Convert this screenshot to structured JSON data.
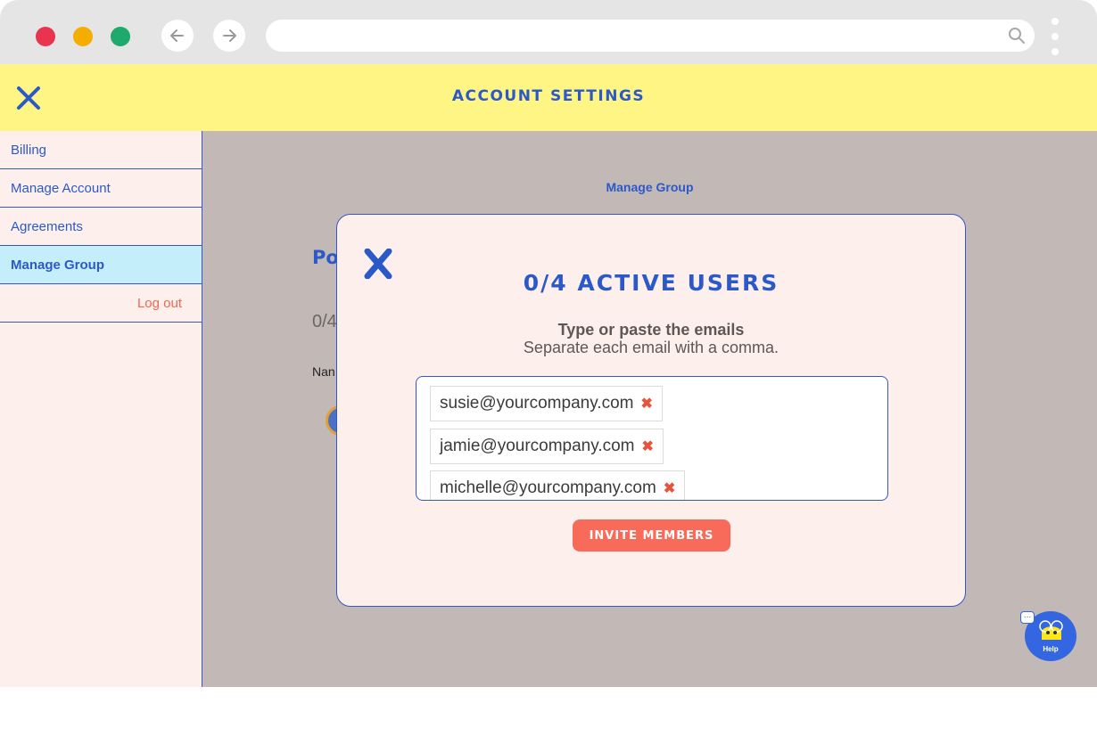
{
  "browser": {
    "traffic_lights": [
      "#e8344e",
      "#f4ad00",
      "#1daa6b"
    ],
    "url": ""
  },
  "header": {
    "title": "ACCOUNT SETTINGS",
    "background": "#fef585"
  },
  "sidebar": {
    "items": [
      {
        "label": "Billing",
        "active": false
      },
      {
        "label": "Manage Account",
        "active": false
      },
      {
        "label": "Agreements",
        "active": false
      },
      {
        "label": "Manage Group",
        "active": true
      }
    ],
    "logout_label": "Log out"
  },
  "main": {
    "subtitle": "Manage Group",
    "heading_partial": "Po",
    "count_partial": "0/4",
    "name_partial": "Nan"
  },
  "modal": {
    "close_label": "X",
    "title": "0/4 ACTIVE USERS",
    "instruction_primary": "Type or paste the emails",
    "instruction_secondary": "Separate each email with a comma.",
    "emails": [
      "susie@yourcompany.com",
      "jamie@yourcompany.com",
      "michelle@yourcompany.com"
    ],
    "remove_symbol": "✖",
    "invite_button": "INVITE MEMBERS"
  },
  "help_widget": {
    "label": "Help",
    "bubble": "..."
  },
  "colors": {
    "accent_blue": "#2c59c9",
    "coral": "#f86b5b",
    "overlay": "#c2b9b7",
    "panel": "#fdf0ec"
  }
}
